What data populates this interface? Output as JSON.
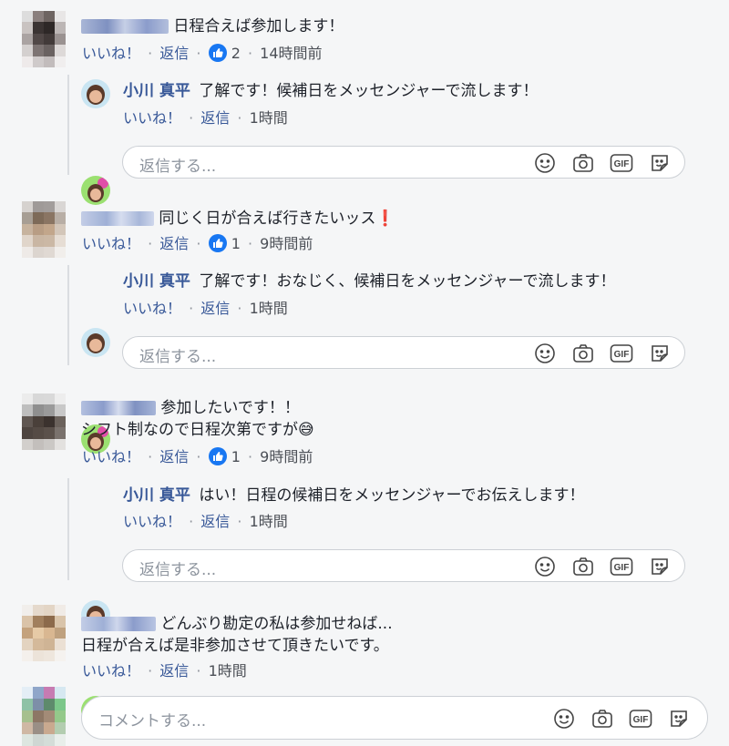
{
  "colors": {
    "link": "#385898",
    "like": "#1877f2",
    "placeholder": "#8d949e"
  },
  "actions": {
    "like": "いいね！",
    "reply": "返信",
    "dot": "·"
  },
  "reply_placeholder": "返信する...",
  "comment_placeholder": "コメントする...",
  "comments": [
    {
      "text": "日程合えば参加します！",
      "likes": "2",
      "time": "14時間前",
      "reply": {
        "author": "小川 真平",
        "text": "了解です！候補日をメッセンジャーで流します！",
        "time": "1時間"
      }
    },
    {
      "text": "同じく日が合えば行きたいッス",
      "emoji": "❗",
      "likes": "1",
      "time": "9時間前",
      "reply": {
        "author": "小川 真平",
        "text": "了解です！おなじく、候補日をメッセンジャーで流します！",
        "time": "1時間"
      }
    },
    {
      "text": "参加したいです！！",
      "text2": "シフト制なので日程次第ですが😅",
      "likes": "1",
      "time": "9時間前",
      "reply": {
        "author": "小川 真平",
        "text": "はい！日程の候補日をメッセンジャーでお伝えします！",
        "time": "1時間"
      }
    },
    {
      "text": "どんぶり勘定の私は参加せねば...",
      "text2": "日程が合えば是非参加させて頂きたいです。",
      "time": "1時間"
    }
  ]
}
